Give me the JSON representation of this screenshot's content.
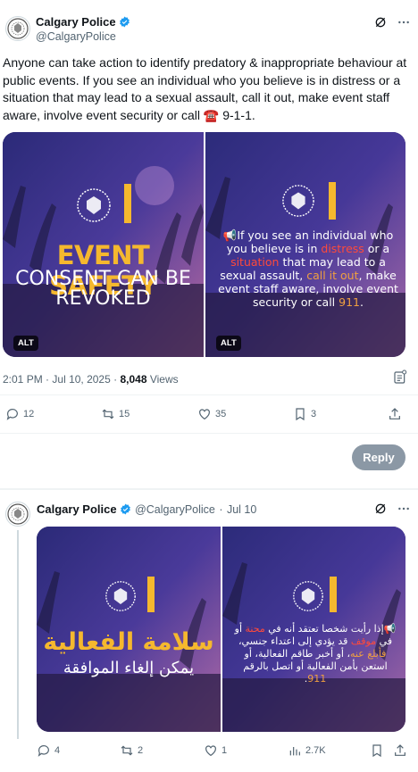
{
  "tweet": {
    "author_name": "Calgary Police",
    "author_handle": "@CalgaryPolice",
    "text_prefix": "Anyone can take action to identify predatory & inappropriate behaviour at public events. If you see an individual who you believe is in distress or a situation that may lead to a sexual assault, call it out, make event staff aware, involve event security or call ",
    "phone_emoji": "☎️",
    "text_suffix": " 9-1-1.",
    "images": [
      {
        "alt_badge": "ALT",
        "line1": "EVENT SAFETY",
        "line2": "CONSENT CAN BE",
        "line3": "REVOKED"
      },
      {
        "alt_badge": "ALT",
        "megaphone": "📢",
        "seg1": "If you see an individual who you believe is in ",
        "seg_distress": "distress",
        "seg2": " or a ",
        "seg_situation": "situation",
        "seg3": " that may lead to a sexual assault, ",
        "seg_callout": "call it out",
        "seg4": ", make event staff aware, involve event security or call ",
        "seg_911": "911",
        "seg5": "."
      }
    ],
    "time": "2:01 PM",
    "dot": "·",
    "date": "Jul 10, 2025",
    "views_count": "8,048",
    "views_label": "Views",
    "actions": {
      "replies": "12",
      "reposts": "15",
      "likes": "35",
      "bookmarks": "3"
    },
    "reply_button": "Reply"
  },
  "reply_tweet": {
    "author_name": "Calgary Police",
    "author_handle": "@CalgaryPolice",
    "dot": "·",
    "date": "Jul 10",
    "images": [
      {
        "line1": "سلامة الفعالية",
        "line2": "يمكن إلغاء الموافقة"
      },
      {
        "megaphone": "📢",
        "seg1": "إذا رأيت شخصا تعتقد أنه في ",
        "seg_a": "محنة",
        "seg2": " أو في ",
        "seg_b": "موقف",
        "seg3": " قد يؤدي إلى اعتداء جنسي، ",
        "seg_c": "فأبلغ عنه",
        "seg4": "، أو أخبر طاقم الفعالية، أو استعن بأمن الفعالية أو اتصل بالرقم ",
        "seg_911": "911",
        "seg5": "."
      }
    ],
    "actions": {
      "replies": "4",
      "reposts": "2",
      "likes": "1",
      "views": "2.7K"
    }
  },
  "colors": {
    "verified": "#1d9bf0",
    "gold": "#f5b82e",
    "muted": "#536471"
  }
}
